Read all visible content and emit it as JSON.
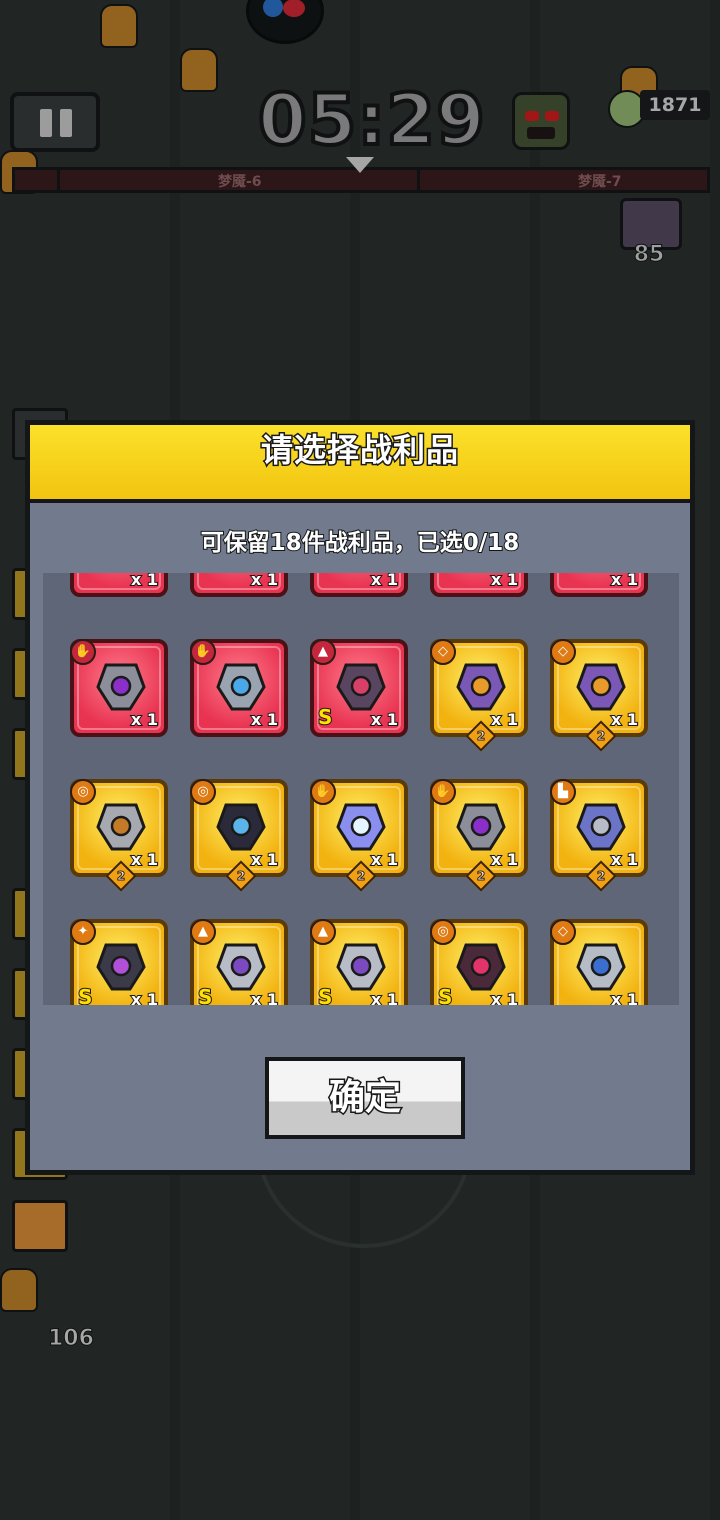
{
  "hud": {
    "timer": "05:29",
    "kill_count": "1871",
    "stage_current": "梦魇-6",
    "stage_next": "梦魇-7",
    "chest_count": "85",
    "bottom_count": "106"
  },
  "dialog": {
    "title": "请选择战利品",
    "subtitle": "可保留18件战利品，已选0/18",
    "confirm_label": "确定"
  },
  "loot_rows": [
    [
      {
        "rarity": "red",
        "icon": "partial-item-icon",
        "qty": "x 1"
      },
      {
        "rarity": "red",
        "icon": "partial-item-icon",
        "qty": "x 1"
      },
      {
        "rarity": "red",
        "icon": "partial-item-icon",
        "qty": "x 1"
      },
      {
        "rarity": "red",
        "icon": "partial-item-icon",
        "qty": "x 1"
      },
      {
        "rarity": "red",
        "icon": "partial-item-icon",
        "qty": "x 1"
      }
    ],
    [
      {
        "rarity": "red",
        "type": "glove",
        "icon": "gauntlet-icon",
        "qty": "x 1"
      },
      {
        "rarity": "red",
        "type": "glove",
        "icon": "ice-gauntlet-icon",
        "qty": "x 1"
      },
      {
        "rarity": "red",
        "type": "armor",
        "icon": "dark-armor-icon",
        "qty": "x 1",
        "rank": "S"
      },
      {
        "rarity": "gold",
        "type": "necklace",
        "icon": "lantern-necklace-icon",
        "qty": "x 1",
        "level": "2"
      },
      {
        "rarity": "gold",
        "type": "necklace",
        "icon": "lantern-necklace-icon",
        "qty": "x 1",
        "level": "2"
      }
    ],
    [
      {
        "rarity": "gold",
        "type": "belt",
        "icon": "rope-belt-icon",
        "qty": "x 1",
        "level": "2"
      },
      {
        "rarity": "gold",
        "type": "belt",
        "icon": "crystal-belt-icon",
        "qty": "x 1",
        "level": "2"
      },
      {
        "rarity": "gold",
        "type": "glove",
        "icon": "feather-glove-icon",
        "qty": "x 1",
        "level": "2"
      },
      {
        "rarity": "gold",
        "type": "glove",
        "icon": "gauntlet-icon",
        "qty": "x 1",
        "level": "2"
      },
      {
        "rarity": "gold",
        "type": "boots",
        "icon": "boots-icon",
        "qty": "x 1",
        "level": "2"
      }
    ],
    [
      {
        "rarity": "gold",
        "type": "weapon",
        "icon": "spiked-blade-icon",
        "qty": "x 1",
        "rank": "S"
      },
      {
        "rarity": "gold",
        "type": "armor",
        "icon": "steel-armor-icon",
        "qty": "x 1",
        "rank": "S"
      },
      {
        "rarity": "gold",
        "type": "armor",
        "icon": "steel-armor-icon",
        "qty": "x 1",
        "rank": "S"
      },
      {
        "rarity": "gold",
        "type": "belt",
        "icon": "ruby-belt-icon",
        "qty": "x 1",
        "rank": "S"
      },
      {
        "rarity": "gold",
        "type": "necklace",
        "icon": "shield-pendant-icon",
        "qty": "x 1"
      }
    ]
  ],
  "colors": {
    "header_yellow": "#fbe12a",
    "panel_bg": "#727b8e",
    "slot_red": "#e83351",
    "slot_gold": "#f2b20f"
  }
}
